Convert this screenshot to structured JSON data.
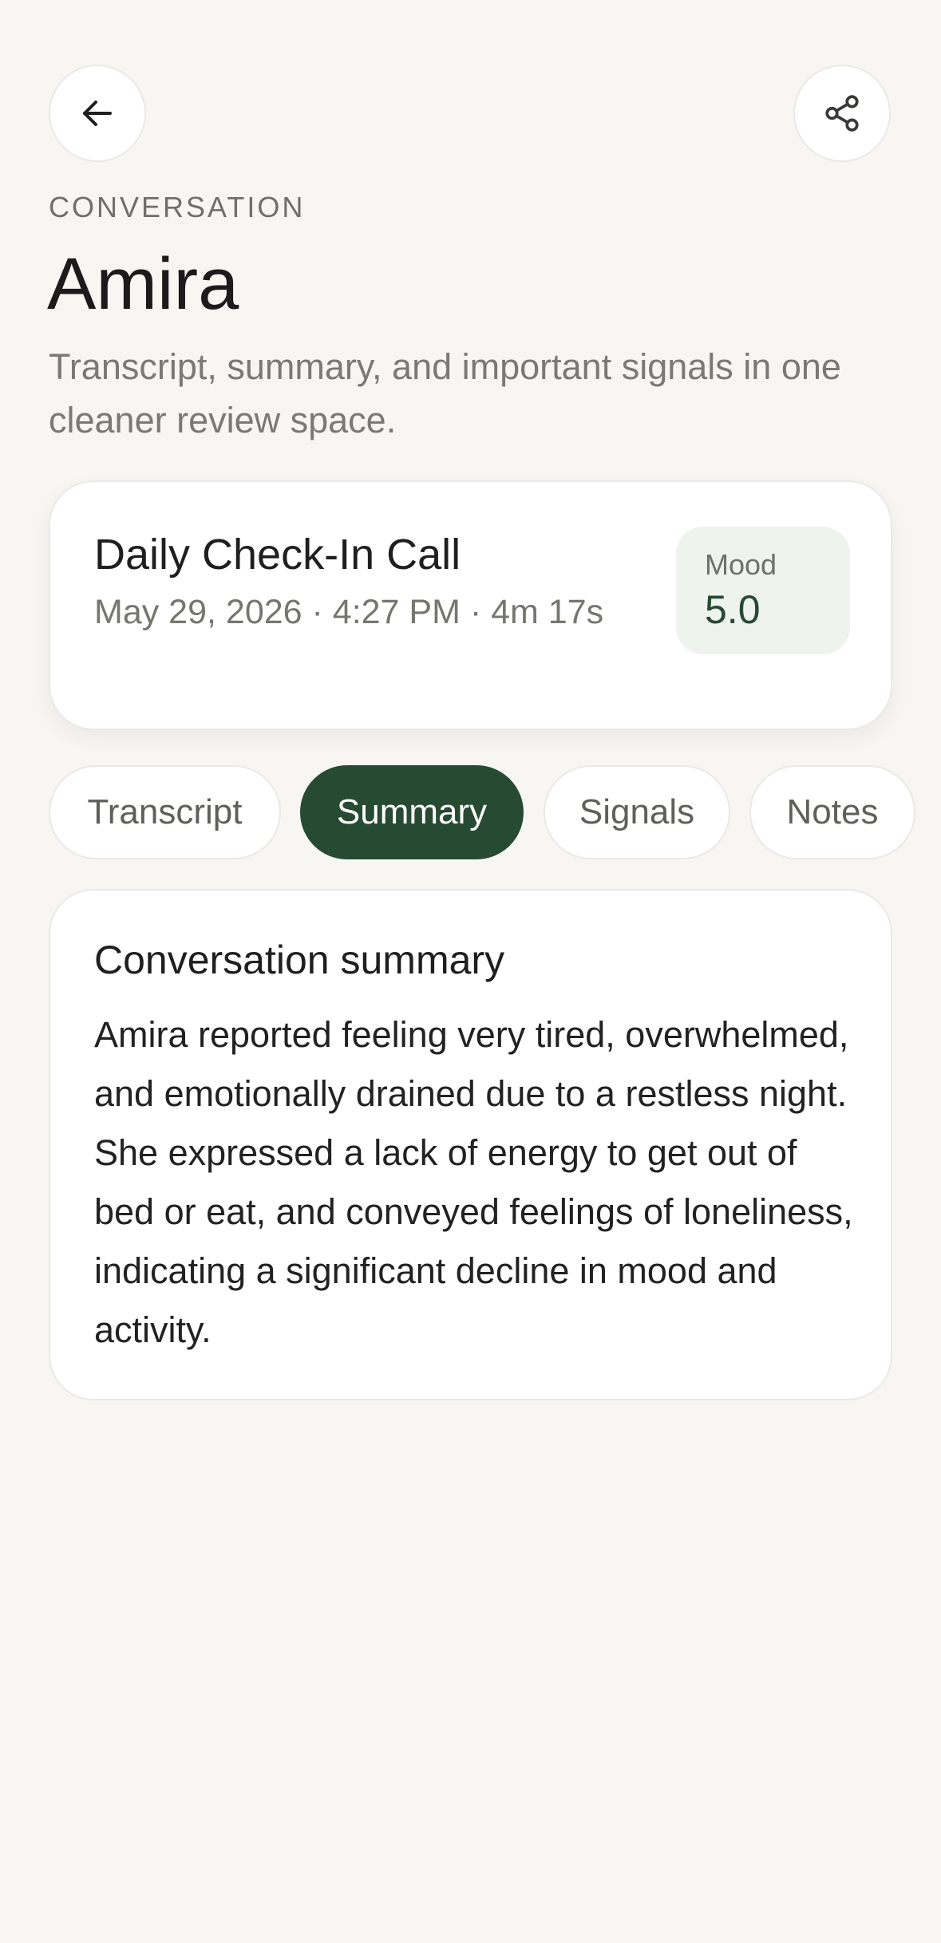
{
  "header": {
    "back_icon": "arrow-left-icon",
    "share_icon": "share-icon",
    "eyebrow": "CONVERSATION",
    "title": "Amira",
    "subtitle": "Transcript, summary, and important signals in one cleaner review space."
  },
  "call_card": {
    "title": "Daily Check-In Call",
    "meta": "May 29, 2026 · 4:27 PM · 4m 17s",
    "mood_label": "Mood",
    "mood_value": "5.0"
  },
  "tabs": [
    {
      "label": "Transcript",
      "active": false
    },
    {
      "label": "Summary",
      "active": true
    },
    {
      "label": "Signals",
      "active": false
    },
    {
      "label": "Notes",
      "active": false
    }
  ],
  "summary": {
    "title": "Conversation summary",
    "body": "Amira reported feeling very tired, overwhelmed, and emotionally drained due to a restless night. She expressed a lack of energy to get out of bed or eat, and conveyed feelings of loneliness, indicating a significant decline in mood and activity."
  },
  "colors": {
    "background": "#f7f6f3",
    "accent": "#274a32",
    "mood_bg": "#eef3ee"
  }
}
